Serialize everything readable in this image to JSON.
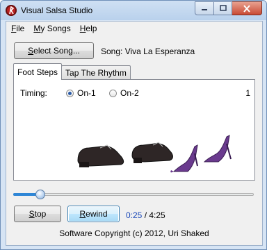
{
  "window": {
    "title": "Visual Salsa Studio",
    "icon": "salsa-app-icon"
  },
  "menu": [
    {
      "mnemonic": "F",
      "rest": "ile"
    },
    {
      "mnemonic": "M",
      "rest": "y Songs"
    },
    {
      "mnemonic": "H",
      "rest": "elp"
    }
  ],
  "song": {
    "button_mnemonic": "S",
    "button_rest": "elect Song...",
    "label": "Song: Viva La Esperanza"
  },
  "tabs": [
    {
      "label": "Foot Steps"
    },
    {
      "label": "Tap The Rhythm"
    }
  ],
  "timing": {
    "label": "Timing:",
    "options": [
      "On-1",
      "On-2"
    ],
    "selected": "On-1",
    "count": "1"
  },
  "playback": {
    "progress_fraction": 0.095,
    "current": "0:25",
    "separator": " / ",
    "total": "4:25"
  },
  "controls": {
    "stop_mnemonic": "S",
    "stop_rest": "top",
    "rewind_mnemonic": "R",
    "rewind_rest": "ewind"
  },
  "footer": {
    "copyright": "Software Copyright (c) 2012, Uri Shaked"
  },
  "colors": {
    "accent": "#2e86d6",
    "time_current": "#1a48b8",
    "men_shoe": "#2a2424",
    "women_shoe": "#6a3a8e"
  }
}
